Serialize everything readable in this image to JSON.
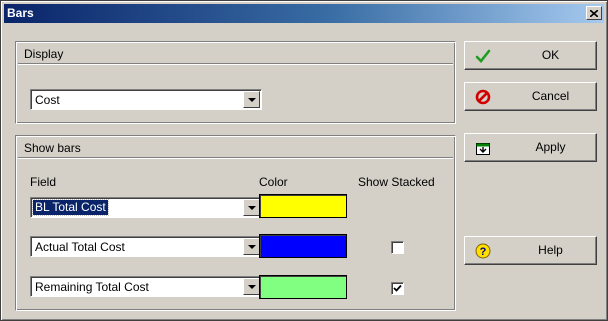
{
  "window": {
    "title": "Bars"
  },
  "display_panel": {
    "header": "Display",
    "selected": "Cost"
  },
  "bars_panel": {
    "header": "Show bars",
    "columns": {
      "field": "Field",
      "color": "Color",
      "stacked": "Show Stacked"
    },
    "rows": [
      {
        "field": "BL Total Cost",
        "color": "#ffff00",
        "stacked": null,
        "selected": true
      },
      {
        "field": "Actual Total Cost",
        "color": "#0000ff",
        "stacked": false,
        "selected": false
      },
      {
        "field": "Remaining Total Cost",
        "color": "#80ff80",
        "stacked": true,
        "selected": false
      }
    ]
  },
  "buttons": {
    "ok": {
      "label": "OK",
      "icon": "checkmark-icon"
    },
    "cancel": {
      "label": "Cancel",
      "icon": "prohibited-icon"
    },
    "apply": {
      "label": "Apply",
      "icon": "apply-icon"
    },
    "help": {
      "label": "Help",
      "icon": "help-icon"
    }
  }
}
